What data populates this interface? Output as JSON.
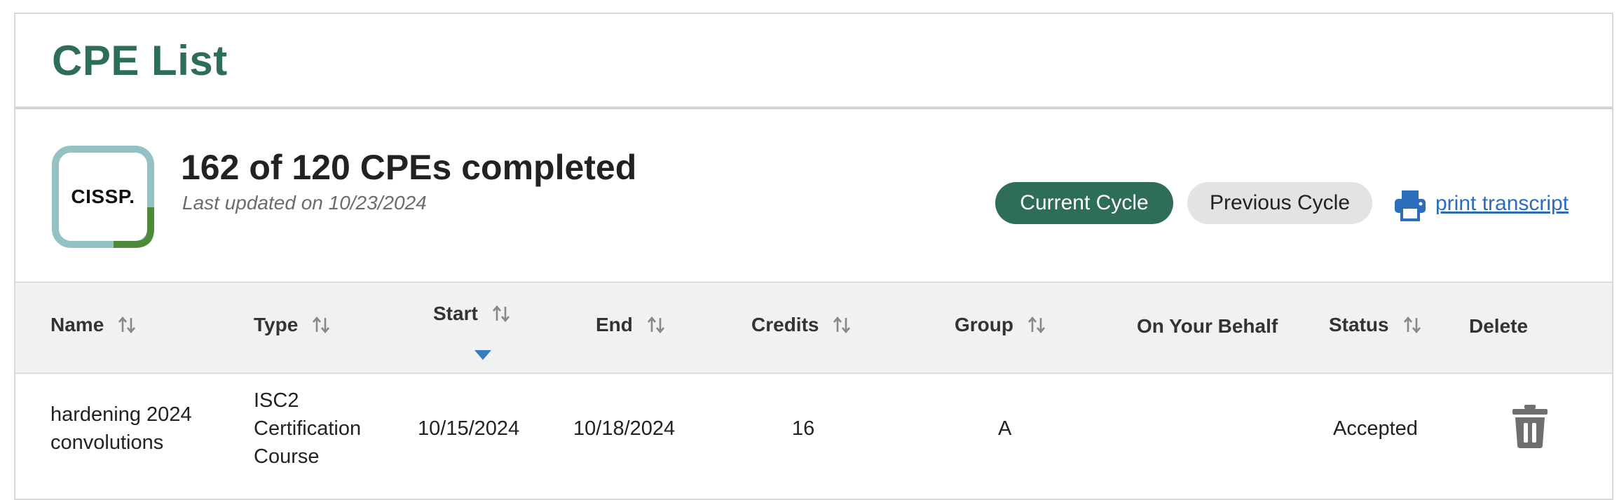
{
  "page": {
    "title": "CPE List"
  },
  "summary": {
    "badge_label": "CISSP.",
    "progress_text": "162 of 120 CPEs completed",
    "last_updated": "Last updated on 10/23/2024"
  },
  "cycles": {
    "current_label": "Current Cycle",
    "previous_label": "Previous Cycle"
  },
  "print": {
    "label": "print transcript",
    "icon": "printer-icon"
  },
  "table": {
    "columns": [
      "Name",
      "Type",
      "Start",
      "End",
      "Credits",
      "Group",
      "On Your Behalf",
      "Status",
      "Delete"
    ],
    "rows": [
      {
        "name_line1": "hardening 2024",
        "name_line2": "convolutions",
        "type_line1": "ISC2",
        "type_line2": "Certification",
        "type_line3": "Course",
        "start": "10/15/2024",
        "end": "10/18/2024",
        "credits": "16",
        "group": "A",
        "on_your_behalf": "",
        "status": "Accepted",
        "delete_icon": "trash-icon"
      }
    ]
  },
  "colors": {
    "brand_green": "#2e6e57",
    "link_blue": "#2a6ebb",
    "badge_teal": "#94c2c4",
    "badge_green": "#4d8a3a"
  }
}
